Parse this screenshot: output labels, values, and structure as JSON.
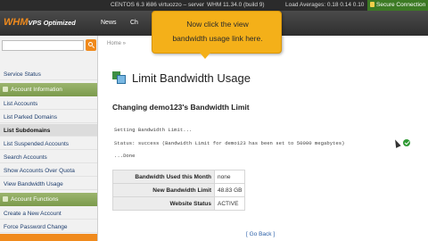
{
  "infobar": {
    "os": "CENTOS 6.3 i686 virtuozzo – server",
    "whm_version": "WHM 11.34.0 (build 9)",
    "load": "Load Averages: 0.18 0.14 0.10",
    "secure": "Secure Connection"
  },
  "header": {
    "logo_main": "WHM",
    "logo_sub": "VPS Optimized",
    "nav": [
      "News",
      "Ch"
    ]
  },
  "breadcrumb": "Home »",
  "sidebar": {
    "items": [
      {
        "label": "Service Status",
        "type": "item"
      },
      {
        "label": "Account Information",
        "type": "head"
      },
      {
        "label": "List Accounts",
        "type": "item"
      },
      {
        "label": "List Parked Domains",
        "type": "item"
      },
      {
        "label": "List Subdomains",
        "type": "active"
      },
      {
        "label": "List Suspended Accounts",
        "type": "item"
      },
      {
        "label": "Search Accounts",
        "type": "item"
      },
      {
        "label": "Show Accounts Over Quota",
        "type": "item"
      },
      {
        "label": "View Bandwidth Usage",
        "type": "item"
      },
      {
        "label": "Account Functions",
        "type": "head"
      },
      {
        "label": "Create a New Account",
        "type": "item"
      },
      {
        "label": "Force Password Change",
        "type": "item"
      },
      {
        "label": "",
        "type": "highlight"
      }
    ]
  },
  "main": {
    "title": "Limit Bandwidth Usage",
    "subtitle": "Changing demo123's Bandwidth Limit",
    "log": [
      "Setting Bandwidth Limit...",
      "Status: success (Bandwidth Limit for demo123 has been set to 50000 megabytes)",
      "...Done"
    ],
    "table": [
      {
        "label": "Bandwidth Used this Month",
        "value": "none"
      },
      {
        "label": "New Bandwidth Limit",
        "value": "48.83 GB"
      },
      {
        "label": "Website Status",
        "value": "ACTIVE"
      }
    ],
    "go_back": "[ Go Back ]"
  },
  "callout": {
    "line1": "Now click the view",
    "line2": "bandwidth usage link here."
  },
  "colors": {
    "accent": "#f08a1c",
    "section_head": "#8aa85c",
    "callout": "#f4b019",
    "secure": "#3c7a24"
  }
}
